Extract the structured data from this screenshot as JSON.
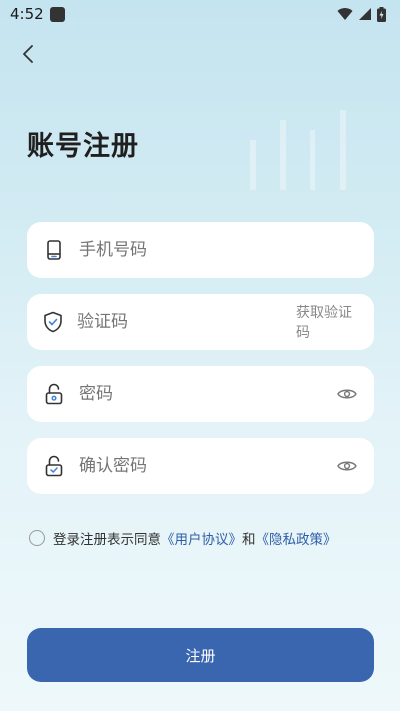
{
  "status_bar": {
    "time": "4:52",
    "icons": [
      "notification-square-icon",
      "wifi-icon",
      "cellular-signal-icon",
      "battery-charging-icon"
    ]
  },
  "header": {
    "back_icon": "chevron-left-icon",
    "title": "账号注册"
  },
  "form": {
    "phone": {
      "placeholder": "手机号码",
      "icon": "phone-icon"
    },
    "code": {
      "placeholder": "验证码",
      "icon": "shield-check-icon",
      "action_label": "获取验证码"
    },
    "password": {
      "placeholder": "密码",
      "icon": "lock-icon",
      "toggle_icon": "eye-icon"
    },
    "confirm_password": {
      "placeholder": "确认密码",
      "icon": "lock-check-icon",
      "toggle_icon": "eye-icon"
    }
  },
  "agreement": {
    "prefix": "登录注册表示同意",
    "user_agreement": "《用户协议》",
    "conjunction": "和",
    "privacy_policy": "《隐私政策》"
  },
  "submit": {
    "label": "注册"
  },
  "colors": {
    "primary": "#3a66b0",
    "link": "#2f5ea8",
    "icon_accent": "#3f84d8"
  }
}
